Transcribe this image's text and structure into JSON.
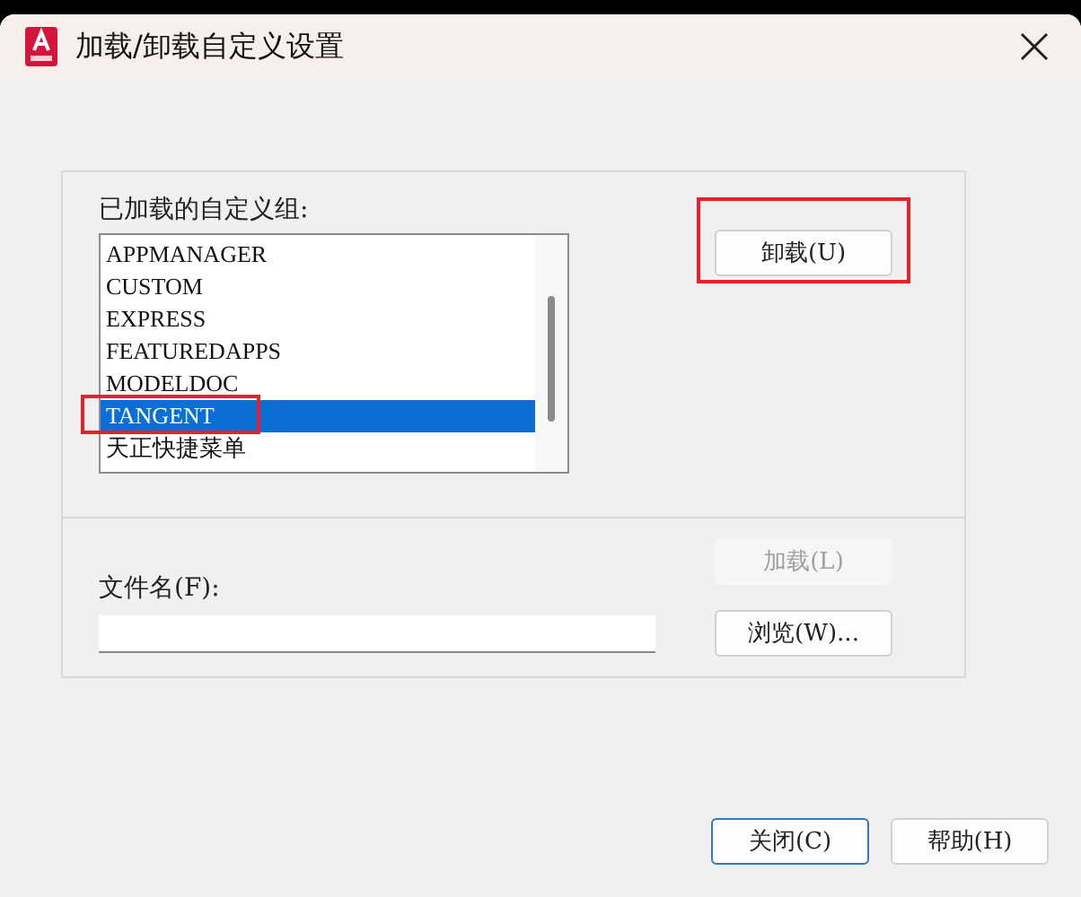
{
  "window": {
    "title": "加载/卸载自定义设置"
  },
  "loaded_groups": {
    "label": "已加载的自定义组:",
    "items": [
      {
        "name": "APPMANAGER",
        "selected": false
      },
      {
        "name": "CUSTOM",
        "selected": false
      },
      {
        "name": "EXPRESS",
        "selected": false
      },
      {
        "name": "FEATUREDAPPS",
        "selected": false
      },
      {
        "name": "MODELDOC",
        "selected": false
      },
      {
        "name": "TANGENT",
        "selected": true
      },
      {
        "name": "天正快捷菜单",
        "selected": false
      }
    ]
  },
  "unload_button": {
    "label": "卸载(U)",
    "disabled": false
  },
  "load_button": {
    "label": "加载(L)",
    "disabled": true
  },
  "file_name": {
    "label": "文件名(F):"
  },
  "browse_button": {
    "label": "浏览(W)...",
    "disabled": false
  },
  "footer_buttons": [
    {
      "label": "关闭(C)",
      "default": true
    },
    {
      "label": "帮助(H)",
      "default": false
    }
  ]
}
